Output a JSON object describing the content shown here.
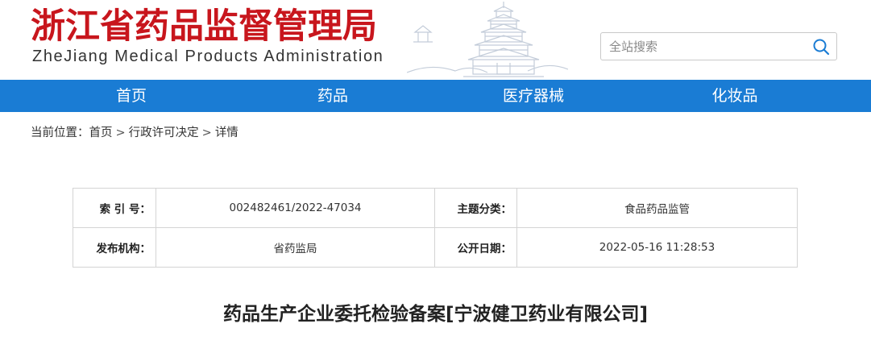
{
  "header": {
    "logo_cn": "浙江省药品监督管理局",
    "logo_en": "ZheJiang Medical Products Administration",
    "search": {
      "placeholder": "全站搜索"
    }
  },
  "nav": {
    "items": [
      {
        "label": "首页"
      },
      {
        "label": "药品"
      },
      {
        "label": "医疗器械"
      },
      {
        "label": "化妆品"
      }
    ]
  },
  "breadcrumb": {
    "prefix": "当前位置：",
    "items": [
      "首页",
      "行政许可决定",
      "详情"
    ],
    "separator": ">"
  },
  "info": {
    "index_label": "索 引 号：",
    "index_value": "002482461/2022-47034",
    "category_label": "主题分类：",
    "category_value": "食品药品监管",
    "publisher_label": "发布机构：",
    "publisher_value": "省药监局",
    "date_label": "公开日期：",
    "date_value": "2022-05-16 11:28:53"
  },
  "article": {
    "title": "药品生产企业委托检验备案[宁波健卫药业有限公司]"
  },
  "colors": {
    "brand_red": "#c8161d",
    "nav_blue": "#1a7cd4",
    "search_icon": "#1a7cd4"
  },
  "icons": [
    "search-icon",
    "pagoda-illustration"
  ]
}
